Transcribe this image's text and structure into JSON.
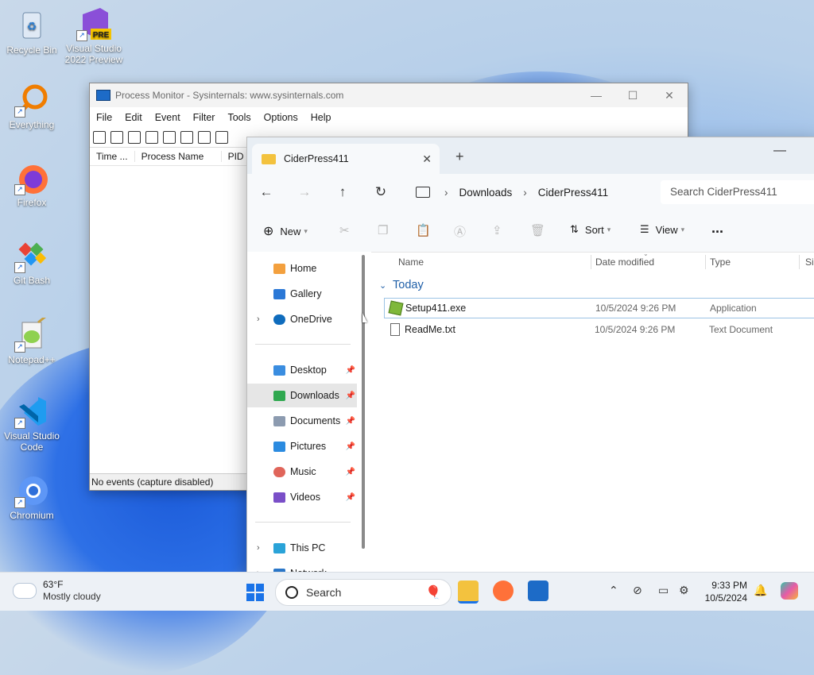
{
  "desktop": {
    "icons": [
      {
        "label": "Recycle Bin"
      },
      {
        "label": "Visual Studio 2022 Preview",
        "badge": "PRE"
      },
      {
        "label": "Everything"
      },
      {
        "label": "Firefox"
      },
      {
        "label": "Git Bash"
      },
      {
        "label": "Notepad++"
      },
      {
        "label": "Visual Studio Code"
      },
      {
        "label": "Chromium"
      }
    ]
  },
  "procmon": {
    "title": "Process Monitor - Sysinternals: www.sysinternals.com",
    "menu": [
      "File",
      "Edit",
      "Event",
      "Filter",
      "Tools",
      "Options",
      "Help"
    ],
    "columns": [
      "Time ...",
      "Process Name",
      "PID"
    ],
    "status": "No events (capture disabled)"
  },
  "explorer": {
    "tab_title": "CiderPress411",
    "breadcrumb": [
      "Downloads",
      "CiderPress411"
    ],
    "search_placeholder": "Search CiderPress411",
    "commands": {
      "new": "New",
      "sort": "Sort",
      "view": "View",
      "more": "..."
    },
    "nav": {
      "home": "Home",
      "gallery": "Gallery",
      "onedrive": "OneDrive",
      "desktop": "Desktop",
      "downloads": "Downloads",
      "documents": "Documents",
      "pictures": "Pictures",
      "music": "Music",
      "videos": "Videos",
      "thispc": "This PC",
      "network": "Network"
    },
    "columns": {
      "name": "Name",
      "date": "Date modified",
      "type": "Type",
      "size": "Siz"
    },
    "group": "Today",
    "files": [
      {
        "name": "Setup411.exe",
        "date": "10/5/2024 9:26 PM",
        "type": "Application"
      },
      {
        "name": "ReadMe.txt",
        "date": "10/5/2024 9:26 PM",
        "type": "Text Document"
      }
    ]
  },
  "taskbar": {
    "temp": "63°F",
    "condition": "Mostly cloudy",
    "search": "Search",
    "time": "9:33 PM",
    "date": "10/5/2024"
  }
}
